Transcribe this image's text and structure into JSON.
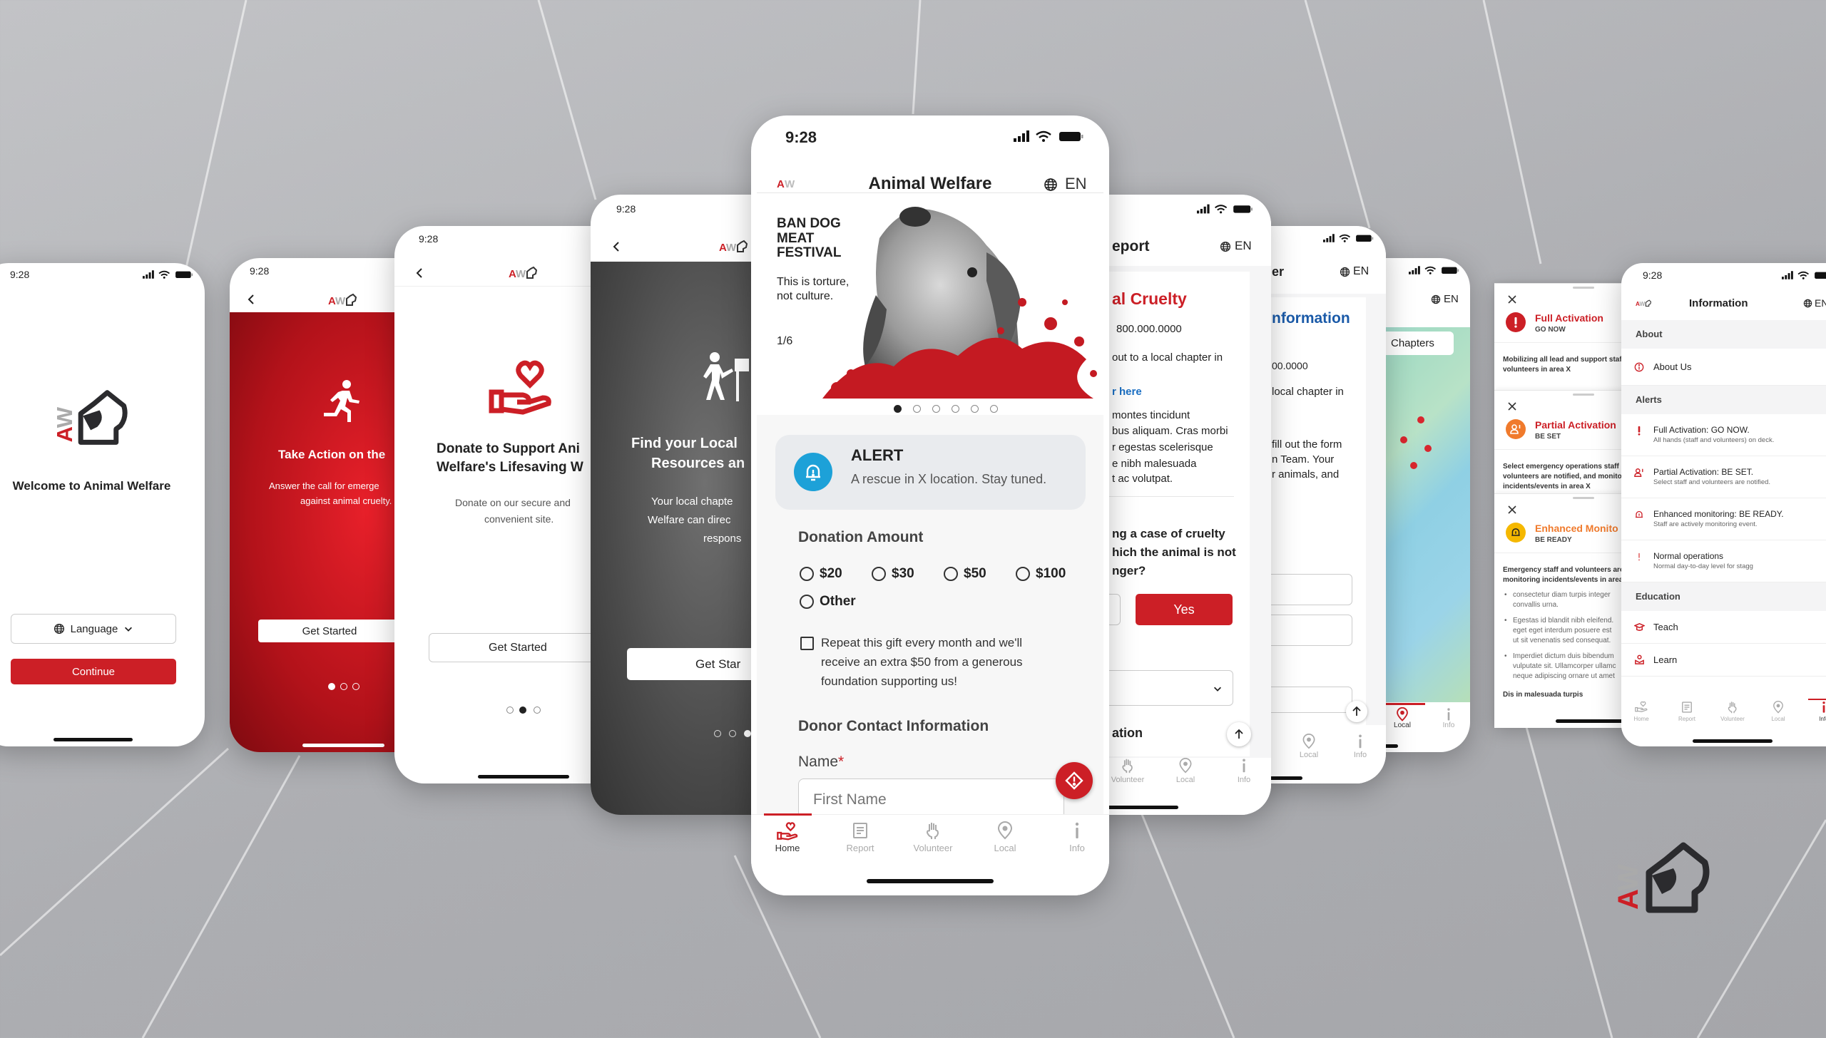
{
  "status_time": "9:28",
  "lang": "EN",
  "brand": {
    "logo_text": "AW",
    "red": "#cc1f26",
    "alert_blue": "#1da1d8",
    "orange": "#f07a2c",
    "yellow": "#f5b800"
  },
  "tabs": [
    "Home",
    "Report",
    "Volunteer",
    "Local",
    "Info"
  ],
  "welcome": {
    "title": "Welcome to Animal Welfare",
    "language_button": "Language",
    "continue_button": "Continue"
  },
  "take_action": {
    "title": "Take Action on the",
    "line1": "Answer the call for emerge",
    "line2": "against animal cruelty.",
    "button": "Get Started",
    "page_index": 1,
    "page_count": 3
  },
  "donate": {
    "title1": "Donate to Support Ani",
    "title2": "Welfare's Lifesaving W",
    "line1": "Donate on our secure and",
    "line2": "convenient site.",
    "button": "Get Started",
    "page_index": 2,
    "page_count": 3
  },
  "find_local": {
    "title1": "Find your Local",
    "title2": "Resources an",
    "line1": "Your local chapte",
    "line2": "Welfare can direc",
    "line3": "respons",
    "button": "Get Star",
    "page_index": 3,
    "page_count": 3
  },
  "home": {
    "title": "Animal Welfare",
    "banner": {
      "headline1": "BAN DOG",
      "headline2": "MEAT",
      "headline3": "FESTIVAL",
      "sub1": "This is torture,",
      "sub2": "not culture.",
      "counter": "1/6",
      "slide_index": 1,
      "slide_count": 6
    },
    "alert": {
      "title": "ALERT",
      "message": "A rescue in X location. Stay tuned."
    },
    "donation": {
      "heading": "Donation Amount",
      "options": [
        "$20",
        "$30",
        "$50",
        "$100",
        "Other"
      ],
      "selected": null,
      "repeat1": "Repeat this gift every month and we'll",
      "repeat2": "receive an extra $50 from a generous",
      "repeat3": "foundation supporting us!",
      "repeat_checked": false
    },
    "contact": {
      "heading": "Donor Contact Information",
      "name_label": "Name",
      "required_mark": "*",
      "first_name_placeholder": "First Name"
    },
    "active_tab": "Home"
  },
  "report": {
    "title": "eport",
    "heading": "al Cruelty",
    "phone": "800.000.0000",
    "line1": "out to a local chapter in",
    "link": "r here",
    "para": [
      "montes tincidunt",
      "bus aliquam. Cras morbi",
      "r egestas scelerisque",
      "e nibh malesuada",
      "t ac volutpat."
    ],
    "question": [
      "ng a case of cruelty",
      "hich the animal is not",
      "nger?"
    ],
    "yes_button": "Yes",
    "section": "ation"
  },
  "volunteer": {
    "title": "er",
    "heading": "nformation",
    "phone": "00.0000",
    "line1": "local chapter in",
    "para": [
      "fill out the form",
      "n Team. Your",
      "r animals, and"
    ]
  },
  "local": {
    "chip": "Chapters",
    "active_tab": "Local"
  },
  "alerts_sheet": [
    {
      "title": "Full Activation",
      "level": "GO NOW",
      "body": [
        "Mobilizing all lead and support staf",
        "volunteers in area X"
      ]
    },
    {
      "title": "Partial Activation",
      "level": "BE SET",
      "body": [
        "Select emergency operations staff",
        "volunteers are notified, and monito",
        "incidents/events in area X"
      ]
    },
    {
      "title": "Enhanced Monito",
      "level": "BE READY",
      "body": [
        "Emergency staff and volunteers are",
        "monitoring incidents/events in area"
      ],
      "bullets": [
        [
          "consectetur diam turpis integer",
          "convallis urna."
        ],
        [
          "Egestas id blandit nibh eleifend.",
          "eget eget interdum posuere est",
          "ut sit venenatis sed consequat."
        ],
        [
          "Imperdiet dictum duis bibendum",
          "vulputate sit. Ullamcorper ullamc",
          "neque adipiscing ornare ut amet"
        ]
      ],
      "footer": "Dis in malesuada turpis"
    }
  ],
  "information": {
    "title": "Information",
    "about": {
      "header": "About",
      "items": [
        "About Us"
      ]
    },
    "alerts": {
      "header": "Alerts",
      "items": [
        {
          "title": "Full Activation: GO NOW.",
          "sub": "All hands (staff and volunteers) on deck."
        },
        {
          "title": "Partial Activation: BE SET.",
          "sub": "Select staff and volunteers are notified."
        },
        {
          "title": "Enhanced monitoring: BE READY.",
          "sub": "Staff are actively monitoring event."
        },
        {
          "title": "Normal operations",
          "sub": "Normal day-to-day level for stagg"
        }
      ]
    },
    "education": {
      "header": "Education",
      "items": [
        "Teach",
        "Learn"
      ]
    },
    "active_tab": "Info"
  }
}
